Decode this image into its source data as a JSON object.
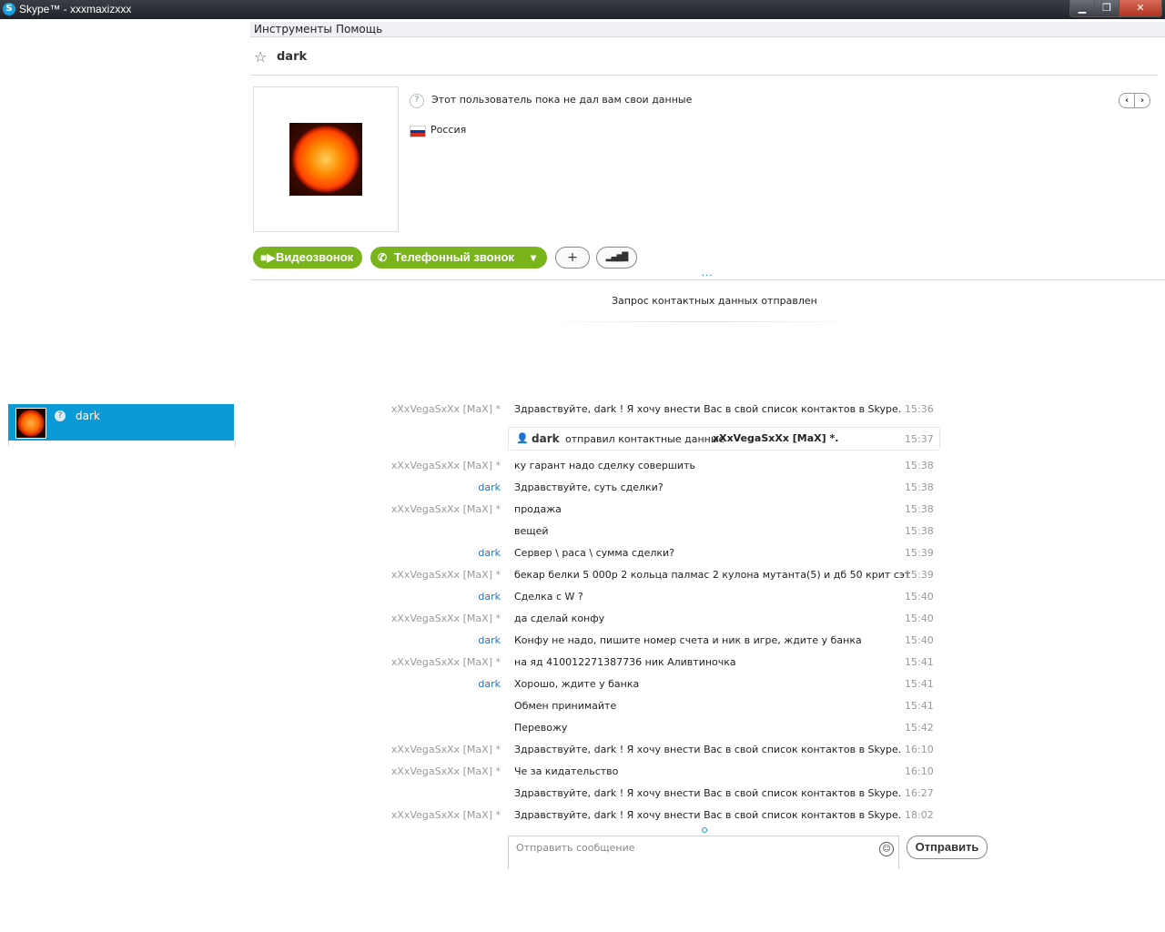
{
  "window": {
    "title": "Skype™ - xxxmaxizxxx",
    "logo_letter": "S",
    "min_glyph": "▁",
    "max_glyph": "❐",
    "close_glyph": "✕"
  },
  "menu": {
    "tools": "Инструменты",
    "help": "Помощь"
  },
  "contact": {
    "name": "dark",
    "status_note": "Этот пользователь пока не дал вам свои данные",
    "country": "Россия",
    "flag_colors": [
      "#ffffff",
      "#0039a6",
      "#d52b1e"
    ]
  },
  "sidebar": {
    "items": [
      {
        "name": "dark",
        "selected": true
      }
    ]
  },
  "actions": {
    "video_call": "Видеозвонок",
    "phone_call": "Телефонный звонок",
    "dropdown_glyph": "▾",
    "add_glyph": "+",
    "signal_glyph": "▂▄▆█",
    "more_dots": "..."
  },
  "notice": "Запрос контактных данных отправлен",
  "system_message": {
    "name": "dark",
    "text": "отправил контактные данные",
    "target": "xXxVegaSxXx [MaX] *.",
    "time": "15:37"
  },
  "messages": [
    {
      "sender": "xXxVegaSxXx [MaX] *",
      "who": "me",
      "text": "Здравствуйте, dark   ! Я хочу внести Вас в свой список контактов в Skype.",
      "time": "15:36"
    },
    {
      "sender": "xXxVegaSxXx [MaX] *",
      "who": "me",
      "text": "ку гарант надо сделку совершить",
      "time": "15:38"
    },
    {
      "sender": "dark",
      "who": "them",
      "text": "Здравствуйте, суть сделки?",
      "time": "15:38"
    },
    {
      "sender": "xXxVegaSxXx [MaX] *",
      "who": "me",
      "text": "продажа",
      "time": "15:38"
    },
    {
      "sender": "",
      "who": "me",
      "text": " вещей",
      "time": "15:38"
    },
    {
      "sender": "dark",
      "who": "them",
      "text": "Сервер \\ раса \\ сумма сделки?",
      "time": "15:39"
    },
    {
      "sender": "xXxVegaSxXx [MaX] *",
      "who": "me",
      "text": "бекар белки 5 000р  2 кольца палмас 2 кулона мутанта(5) и дб 50 крит сэт",
      "time": "15:39"
    },
    {
      "sender": "dark",
      "who": "them",
      "text": "Сделка с W ?",
      "time": "15:40"
    },
    {
      "sender": "xXxVegaSxXx [MaX] *",
      "who": "me",
      "text": "да сделай конфу",
      "time": "15:40"
    },
    {
      "sender": "dark",
      "who": "them",
      "text": "Конфу не надо, пишите номер счета и ник в игре, ждите у банка",
      "time": "15:40"
    },
    {
      "sender": "xXxVegaSxXx [MaX] *",
      "who": "me",
      "text": "на яд  410012271387736  ник Аливтиночка",
      "time": "15:41"
    },
    {
      "sender": "dark",
      "who": "them",
      "text": "Хорошо, ждите у банка",
      "time": "15:41"
    },
    {
      "sender": "",
      "who": "them",
      "text": "Обмен принимайте",
      "time": "15:41"
    },
    {
      "sender": "",
      "who": "them",
      "text": "Перевожу",
      "time": "15:42"
    },
    {
      "sender": "xXxVegaSxXx [MaX] *",
      "who": "me",
      "text": "Здравствуйте, dark   ! Я хочу внести Вас в свой список контактов в Skype.",
      "time": "16:10"
    },
    {
      "sender": "xXxVegaSxXx [MaX] *",
      "who": "me",
      "text": "Че за кидательство",
      "time": "16:10"
    },
    {
      "sender": "",
      "who": "me",
      "text": "Здравствуйте, dark   ! Я хочу внести Вас в свой список контактов в Skype.",
      "time": "16:27"
    },
    {
      "sender": "xXxVegaSxXx [MaX] *",
      "who": "me",
      "text": "Здравствуйте, dark   ! Я хочу внести Вас в свой список контактов в Skype.",
      "time": "18:02"
    }
  ],
  "composer": {
    "placeholder": "Отправить сообщение",
    "send_label": "Отправить",
    "emoji_glyph": "☺"
  }
}
